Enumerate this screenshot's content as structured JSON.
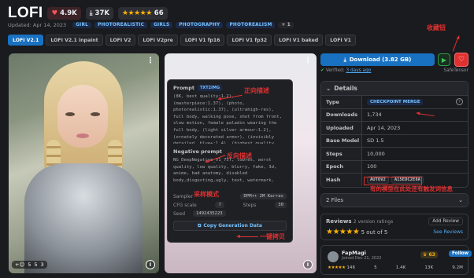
{
  "header": {
    "title": "LOFI",
    "likes": "4.9K",
    "downloads": "37K",
    "rating_count": "66"
  },
  "meta": {
    "updated": "Updated: Apr 14, 2023",
    "tags": [
      "GIRL",
      "PHOTOREALISTIC",
      "GIRLS",
      "PHOTOGRAPHY",
      "PHOTOREALISM"
    ],
    "more_tags": "+ 1"
  },
  "versions": [
    "LOFI V2.1",
    "LOFI V2.1 inpaint",
    "LOFI V2",
    "LOFI V2pre",
    "LOFI V1 fp16",
    "LOFI V1 fp32",
    "LOFI V1 baked",
    "LOFI V1"
  ],
  "active_version": 0,
  "image1": {
    "reactions": [
      "+☺",
      "5",
      "5",
      "3"
    ]
  },
  "image2": {
    "info_icon": "i"
  },
  "generation": {
    "prompt_label": "Prompt",
    "prompt_badge": "TXT2IMG",
    "prompt_text": "(8K, best quality:1.2),\n(masterpiece:1.37), (photo,\nphotorealistic:1.37), (ultrahigh-res),\nfull body, walking pose, shot from front,\nslow motion, female paladin wearing the\nfull body, (light silver armour:1.2),\n(ornately decorated armor), (invisibly\ndetailed, blue+:1.4), (highest quality",
    "negative_label": "Negative prompt",
    "negative_text": "NG_DeepNegative_V1_75T, lowres, worst\nquality, low quality, blurry, fake, 3d,\nanime, bad anatomy, disabled\nbody,disgusting,ugly, text, watermark,",
    "sampler_label": "Sampler",
    "sampler_value": "DPM++ 2M Karras",
    "cfg_label": "CFG scale",
    "cfg_value": "7",
    "steps_label": "Steps",
    "steps_value": "30",
    "seed_label": "Seed",
    "seed_value": "1492435223",
    "copy_label": "Copy Generation Data"
  },
  "actions": {
    "download_label": "Download (3.82 GB)",
    "verified_label": "Verified:",
    "verified_date": "3 days ago",
    "safetensor": "SafeTensor"
  },
  "details": {
    "heading": "Details",
    "rows": [
      {
        "key": "Type",
        "value": "CHECKPOINT MERGE"
      },
      {
        "key": "Downloads",
        "value": "1,734"
      },
      {
        "key": "Uploaded",
        "value": "Apr 14, 2023"
      },
      {
        "key": "Base Model",
        "value": "SD 1.5"
      },
      {
        "key": "Steps",
        "value": "10,000"
      },
      {
        "key": "Epoch",
        "value": "100"
      },
      {
        "key": "Hash",
        "value": "AUTOV2",
        "extra": "A15EDC2E8A"
      }
    ]
  },
  "files": {
    "label": "2 Files"
  },
  "reviews": {
    "title": "Reviews",
    "versions_note": "2 version ratings",
    "add_label": "Add Review",
    "score": "5 out of 5",
    "see_label": "See Reviews"
  },
  "creator": {
    "name": "FapMagi",
    "joined": "Joined Dec 21, 2022",
    "rank": "63",
    "follow_label": "Follow",
    "stats": [
      "146",
      "5",
      "1.4K",
      "13K",
      "9.2M"
    ]
  },
  "annotations": {
    "favorite": "收藏钮",
    "prompt": "正向描述",
    "negative": "反向描述",
    "sampler": "采样模式",
    "copy": "一键拷贝",
    "hash": "有的模型在此处还有触发词信息"
  },
  "colors": {
    "accent": "#1971c2",
    "favorite": "#e03131",
    "annotation": "#e03131",
    "run": "#40c057"
  }
}
